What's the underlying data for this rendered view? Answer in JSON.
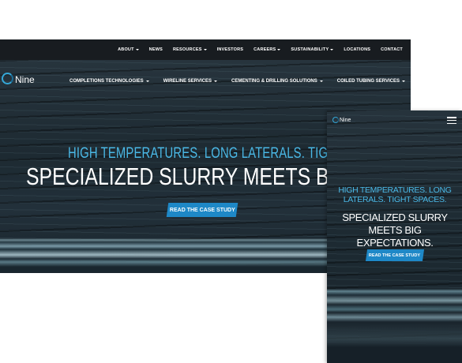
{
  "desktop": {
    "utility_nav": [
      {
        "label": "ABOUT",
        "dropdown": true
      },
      {
        "label": "NEWS",
        "dropdown": false
      },
      {
        "label": "RESOURCES",
        "dropdown": true
      },
      {
        "label": "INVESTORS",
        "dropdown": false
      },
      {
        "label": "CAREERS",
        "dropdown": true
      },
      {
        "label": "SUSTAINABILITY",
        "dropdown": true
      },
      {
        "label": "LOCATIONS",
        "dropdown": false
      },
      {
        "label": "CONTACT",
        "dropdown": false
      }
    ],
    "logo_text": "Nine",
    "main_nav": [
      {
        "label": "COMPLETIONS TECHNOLOGIES",
        "dropdown": true
      },
      {
        "label": "WIRELINE SERVICES",
        "dropdown": true
      },
      {
        "label": "CEMENTING & DRILLING SOLUTIONS",
        "dropdown": true
      },
      {
        "label": "COILED TUBING SERVICES",
        "dropdown": true
      }
    ],
    "hero": {
      "tagline": "HIGH TEMPERATURES. LONG LATERALS. TIGHT SPACES.",
      "headline": "SPECIALIZED SLURRY MEETS BIG EXPECTATIONS.",
      "cta": "READ THE CASE STUDY"
    }
  },
  "mobile": {
    "logo_text": "Nine",
    "menu_icon": "hamburger-icon",
    "hero": {
      "tagline": "HIGH TEMPERATURES. LONG LATERALS. TIGHT SPACES.",
      "headline": "SPECIALIZED SLURRY MEETS BIG EXPECTATIONS.",
      "cta": "READ THE CASE STUDY"
    }
  },
  "colors": {
    "accent": "#4ab8e6",
    "button": "#1e88c7",
    "topbar": "#181c20",
    "hero_bg": "#1f2c35"
  }
}
